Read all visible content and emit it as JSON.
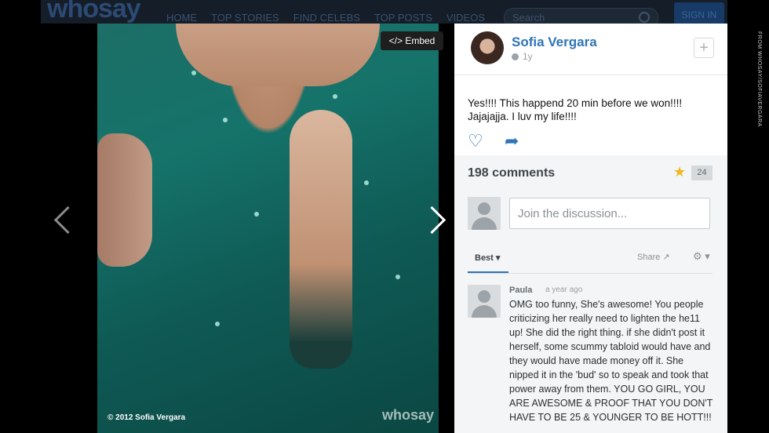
{
  "site": {
    "logo": "whosay",
    "nav": [
      "HOME",
      "TOP STORIES",
      "FIND CELEBS",
      "TOP POSTS",
      "VIDEOS"
    ],
    "search_placeholder": "Search",
    "signin_label": "SIGN IN"
  },
  "photo_credit": "FROM WHOSAY/SOFIAVERGARA",
  "viewer": {
    "embed_label": "</> Embed",
    "copyright": "© 2012 Sofia Vergara",
    "watermark": "whosay"
  },
  "panel": {
    "author_name": "Sofia Vergara",
    "age": "1y",
    "post_text": "Yes!!!! This happend 20 min before we won!!!! Jajajajja. I luv my life!!!!",
    "comments_count_label": "198 comments",
    "star_count": "24",
    "join_placeholder": "Join the discussion...",
    "sort_label": "Best",
    "share_label": "Share",
    "comment": {
      "author": "Paula",
      "time": "a year ago",
      "text": "OMG too funny, She's awesome! You people criticizing her really need to lighten the he11 up! She did the right thing. if she didn't post it herself, some scummy tabloid would have and they would have made money off it. She nipped it in the 'bud' so to speak and took that power away from them. YOU GO GIRL, YOU ARE AWESOME & PROOF THAT YOU DON'T HAVE TO BE 25 & YOUNGER TO BE HOTT!!!"
    }
  },
  "icons": {
    "heart": "heart-icon",
    "share": "share-arrow-icon",
    "star": "star-icon",
    "gear": "gear-icon"
  },
  "colors": {
    "accent": "#2f74b5",
    "star": "#f3b61c",
    "topbar": "#141d28"
  }
}
